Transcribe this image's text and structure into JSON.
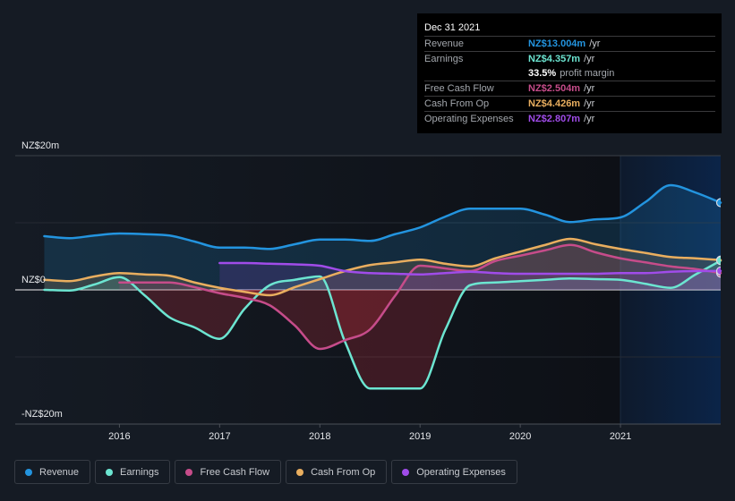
{
  "tooltip": {
    "date": "Dec 31 2021",
    "revenue": {
      "label": "Revenue",
      "value": "NZ$13.004m",
      "unit": "/yr",
      "color": "#2394df"
    },
    "earnings": {
      "label": "Earnings",
      "value": "NZ$4.357m",
      "unit": "/yr",
      "color": "#6ce5d1"
    },
    "profit_margin": {
      "value": "33.5%",
      "label": "profit margin"
    },
    "free_cash_flow": {
      "label": "Free Cash Flow",
      "value": "NZ$2.504m",
      "unit": "/yr",
      "color": "#c64c8a"
    },
    "cash_from_op": {
      "label": "Cash From Op",
      "value": "NZ$4.426m",
      "unit": "/yr",
      "color": "#e9ae5f"
    },
    "operating_expenses": {
      "label": "Operating Expenses",
      "value": "NZ$2.807m",
      "unit": "/yr",
      "color": "#a04ce9"
    }
  },
  "legend": [
    {
      "label": "Revenue",
      "color": "#2394df"
    },
    {
      "label": "Earnings",
      "color": "#6ce5d1"
    },
    {
      "label": "Free Cash Flow",
      "color": "#c64c8a"
    },
    {
      "label": "Cash From Op",
      "color": "#e9ae5f"
    },
    {
      "label": "Operating Expenses",
      "color": "#a04ce9"
    }
  ],
  "chart_data": {
    "type": "line",
    "title": "",
    "xlabel": "",
    "ylabel": "",
    "units": "NZ$m",
    "x": [
      2015.25,
      2015.5,
      2015.75,
      2016.0,
      2016.25,
      2016.5,
      2016.75,
      2017.0,
      2017.25,
      2017.5,
      2017.75,
      2018.0,
      2018.25,
      2018.5,
      2018.75,
      2019.0,
      2019.25,
      2019.5,
      2019.75,
      2020.0,
      2020.25,
      2020.5,
      2020.75,
      2021.0,
      2021.25,
      2021.5,
      2021.75,
      2022.0
    ],
    "series": [
      {
        "name": "Revenue",
        "key": "revenue",
        "color": "#2394df",
        "values": [
          8.0,
          7.7,
          8.1,
          8.4,
          8.3,
          8.1,
          7.2,
          6.3,
          6.3,
          6.1,
          6.8,
          7.5,
          7.5,
          7.3,
          8.3,
          9.3,
          10.9,
          12.1,
          12.1,
          12.1,
          11.2,
          10.1,
          10.5,
          10.8,
          13.1,
          15.6,
          14.5,
          13.0
        ]
      },
      {
        "name": "Cash From Op",
        "key": "cash_from_op",
        "color": "#e9ae5f",
        "values": [
          1.5,
          1.3,
          2.0,
          2.5,
          2.3,
          2.1,
          1.1,
          0.3,
          -0.3,
          -0.8,
          0.4,
          1.6,
          2.8,
          3.7,
          4.1,
          4.5,
          3.9,
          3.5,
          4.7,
          5.7,
          6.7,
          7.6,
          6.8,
          6.1,
          5.5,
          4.9,
          4.7,
          4.43
        ]
      },
      {
        "name": "Earnings",
        "key": "earnings",
        "color": "#6ce5d1",
        "values": [
          0.0,
          -0.1,
          0.8,
          1.9,
          -0.8,
          -4.1,
          -5.6,
          -7.3,
          -2.8,
          0.7,
          1.5,
          2.0,
          -7.7,
          -14.7,
          -14.7,
          -14.7,
          -6.0,
          0.7,
          1.1,
          1.3,
          1.5,
          1.7,
          1.6,
          1.5,
          0.9,
          0.3,
          2.3,
          4.36
        ]
      },
      {
        "name": "Free Cash Flow",
        "key": "free_cash_flow",
        "color": "#c64c8a",
        "values": [
          null,
          null,
          null,
          1.1,
          1.1,
          1.1,
          0.4,
          -0.5,
          -1.2,
          -2.3,
          -5.3,
          -8.8,
          -7.5,
          -5.9,
          -0.9,
          3.6,
          3.2,
          2.8,
          4.3,
          5.1,
          5.9,
          6.7,
          5.6,
          4.7,
          4.1,
          3.5,
          3.1,
          2.5
        ]
      },
      {
        "name": "Operating Expenses",
        "key": "operating_expenses",
        "color": "#a04ce9",
        "values": [
          null,
          null,
          null,
          null,
          null,
          null,
          null,
          4.0,
          4.0,
          3.9,
          3.8,
          3.6,
          2.8,
          2.5,
          2.4,
          2.3,
          2.5,
          2.7,
          2.5,
          2.4,
          2.4,
          2.4,
          2.4,
          2.5,
          2.5,
          2.7,
          2.8,
          2.81
        ]
      }
    ],
    "xlim": [
      2014.96,
      2022.0
    ],
    "ylim": [
      -20,
      20
    ],
    "yticks": [
      {
        "value": 20,
        "label": "NZ$20m"
      },
      {
        "value": 0,
        "label": "NZ$0"
      },
      {
        "value": -20,
        "label": "-NZ$20m"
      }
    ],
    "ygrid": [
      20,
      10,
      0,
      -10,
      -20
    ],
    "xticks": [
      {
        "value": 2016,
        "label": "2016"
      },
      {
        "value": 2017,
        "label": "2017"
      },
      {
        "value": 2018,
        "label": "2018"
      },
      {
        "value": 2019,
        "label": "2019"
      },
      {
        "value": 2020,
        "label": "2020"
      },
      {
        "value": 2021,
        "label": "2021"
      }
    ],
    "highlight_range": [
      2021.0,
      2022.0
    ],
    "negative_fill_color": "#c0303c",
    "grid": true,
    "legend_position": "bottom-left"
  }
}
